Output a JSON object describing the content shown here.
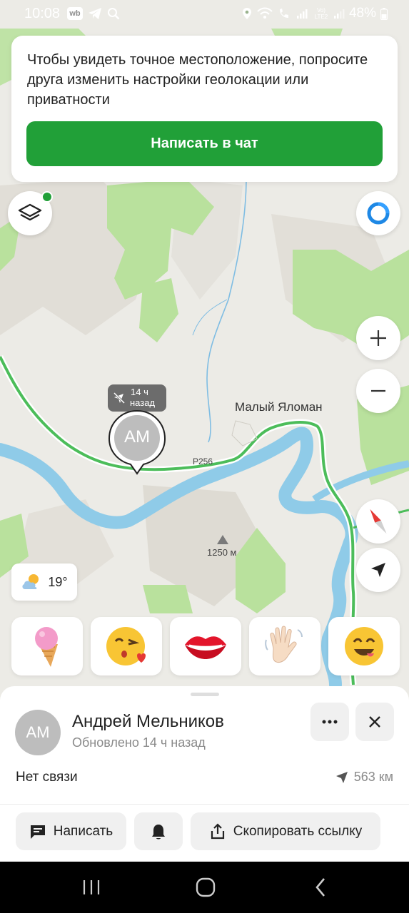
{
  "status_bar": {
    "time": "10:08",
    "app_badge": "wb",
    "battery": "48%",
    "net_label": "Vo) LTE2"
  },
  "banner": {
    "message": "Чтобы увидеть точное местоположение, попросите друга изменить настройки геолокации или приватности",
    "button_label": "Написать в чат"
  },
  "map": {
    "village_label": "Малый Яломан",
    "road_label": "P256",
    "peak_label": "1250 м",
    "friend_marker": {
      "initials": "АМ",
      "time_line1": "14 ч",
      "time_line2": "назад"
    }
  },
  "weather": {
    "temperature": "19°",
    "icon": "partly-cloudy-icon"
  },
  "emoji_reactions": [
    "ice-cream",
    "kissing-heart",
    "lips",
    "waving-hand",
    "smiling-face"
  ],
  "contact": {
    "initials": "АМ",
    "name": "Андрей Мельников",
    "updated": "Обновлено 14 ч назад",
    "connection": "Нет связи",
    "distance": "563 км"
  },
  "actions": {
    "write": "Написать",
    "copy_link": "Скопировать ссылку"
  },
  "colors": {
    "accent_green": "#21a038",
    "river": "#8fcbe8",
    "forest": "#b8e0a0",
    "road": "#4cbd5a",
    "compass_red": "#e53935",
    "location_blue": "#1e88e5"
  }
}
